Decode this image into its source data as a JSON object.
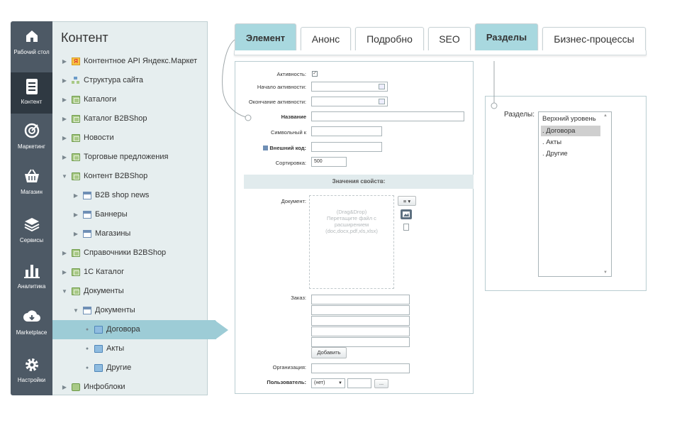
{
  "leftbar": {
    "items": [
      {
        "label": "Рабочий стол",
        "icon": "home-icon"
      },
      {
        "label": "Контент",
        "icon": "document-icon",
        "active": true
      },
      {
        "label": "Маркетинг",
        "icon": "target-icon"
      },
      {
        "label": "Магазин",
        "icon": "basket-icon"
      },
      {
        "label": "Сервисы",
        "icon": "layers-icon"
      },
      {
        "label": "Аналитика",
        "icon": "bar-chart-icon"
      },
      {
        "label": "Marketplace",
        "icon": "cloud-download-icon"
      },
      {
        "label": "Настройки",
        "icon": "gear-icon"
      }
    ]
  },
  "tree": {
    "title": "Контент",
    "items": [
      {
        "label": "Контентное API Яндекс.Маркет",
        "icon": "yandex-icon"
      },
      {
        "label": "Структура сайта",
        "icon": "structure-icon"
      },
      {
        "label": "Каталоги",
        "icon": "iblock-icon"
      },
      {
        "label": "Каталог B2BShop",
        "icon": "iblock-icon"
      },
      {
        "label": "Новости",
        "icon": "iblock-icon"
      },
      {
        "label": "Торговые предложения",
        "icon": "iblock-icon"
      },
      {
        "label": "Контент B2BShop",
        "icon": "iblock-icon"
      },
      {
        "label": "B2B shop news",
        "icon": "list-icon"
      },
      {
        "label": "Баннеры",
        "icon": "list-icon"
      },
      {
        "label": "Магазины",
        "icon": "list-icon"
      },
      {
        "label": "Справочники B2BShop",
        "icon": "iblock-icon"
      },
      {
        "label": "1С Каталог",
        "icon": "iblock-icon"
      },
      {
        "label": "Документы",
        "icon": "iblock-icon"
      },
      {
        "label": "Документы",
        "icon": "list-icon"
      },
      {
        "label": "Договора",
        "icon": "folder-icon"
      },
      {
        "label": "Акты",
        "icon": "folder-icon"
      },
      {
        "label": "Другие",
        "icon": "folder-icon"
      },
      {
        "label": "Инфоблоки",
        "icon": "iblock-settings-icon"
      }
    ]
  },
  "tabs": [
    {
      "label": "Элемент",
      "active": true
    },
    {
      "label": "Анонс"
    },
    {
      "label": "Подробно"
    },
    {
      "label": "SEO"
    },
    {
      "label": "Разделы",
      "active": true
    },
    {
      "label": "Бизнес-процессы"
    }
  ],
  "form": {
    "active_label": "Активность:",
    "active_checked": true,
    "start_label": "Начало активности:",
    "end_label": "Окончание активности:",
    "name_label": "Название",
    "code_label": "Символьный к",
    "external_label": "Внешний код:",
    "sort_label": "Сортировка:",
    "sort_value": "500",
    "props_header": "Значения свойств:",
    "document_label": "Документ:",
    "dropzone_text": "(Drag&Drop)\nПеретащите файл с расширением\n(doc,docx,pdf,xls,xlsx)",
    "order_label": "Заказ:",
    "add_button": "Добавить",
    "org_label": "Организация:",
    "user_label": "Пользователь:",
    "user_select": "(нет)",
    "dots_button": "..."
  },
  "sections": {
    "label": "Разделы:",
    "options": [
      {
        "label": "Верхний уровень"
      },
      {
        "label": ". Договора",
        "selected": true
      },
      {
        "label": ". Акты"
      },
      {
        "label": ". Другие"
      }
    ]
  },
  "colors": {
    "leftbar": "#4d5965",
    "tree_bg": "#e6eeef",
    "accent": "#a8d8df",
    "selection": "#9dccd6"
  }
}
